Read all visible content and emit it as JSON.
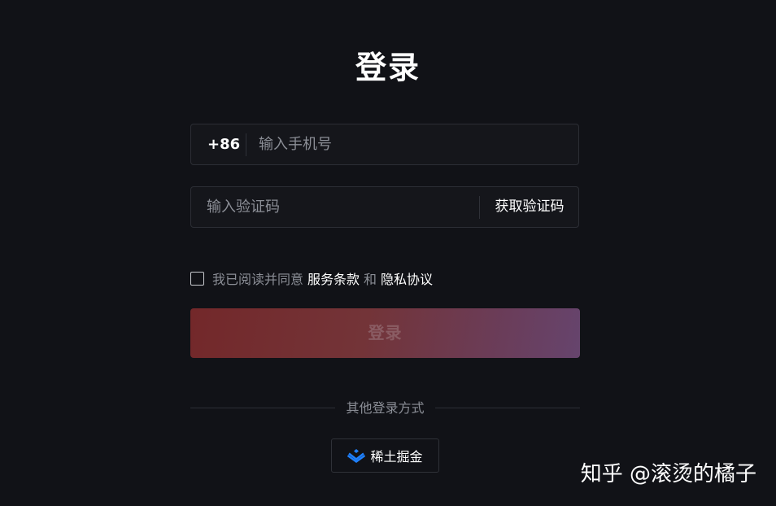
{
  "title": "登录",
  "phone": {
    "country_code": "+86",
    "placeholder": "输入手机号"
  },
  "code": {
    "placeholder": "输入验证码",
    "get_code_label": "获取验证码"
  },
  "agreement": {
    "prefix": "我已阅读并同意",
    "terms": "服务条款",
    "and": "和",
    "privacy": "隐私协议",
    "checked": false
  },
  "login_button": "登录",
  "other_methods": {
    "label": "其他登录方式",
    "providers": [
      {
        "name": "稀土掘金",
        "icon": "juejin-logo-icon"
      }
    ]
  },
  "watermark": "知乎 @滚烫的橘子",
  "colors": {
    "background": "#111217",
    "button_gradient_start": "#73282a",
    "button_gradient_end": "#66446d",
    "provider_icon": "#1e80ff"
  }
}
